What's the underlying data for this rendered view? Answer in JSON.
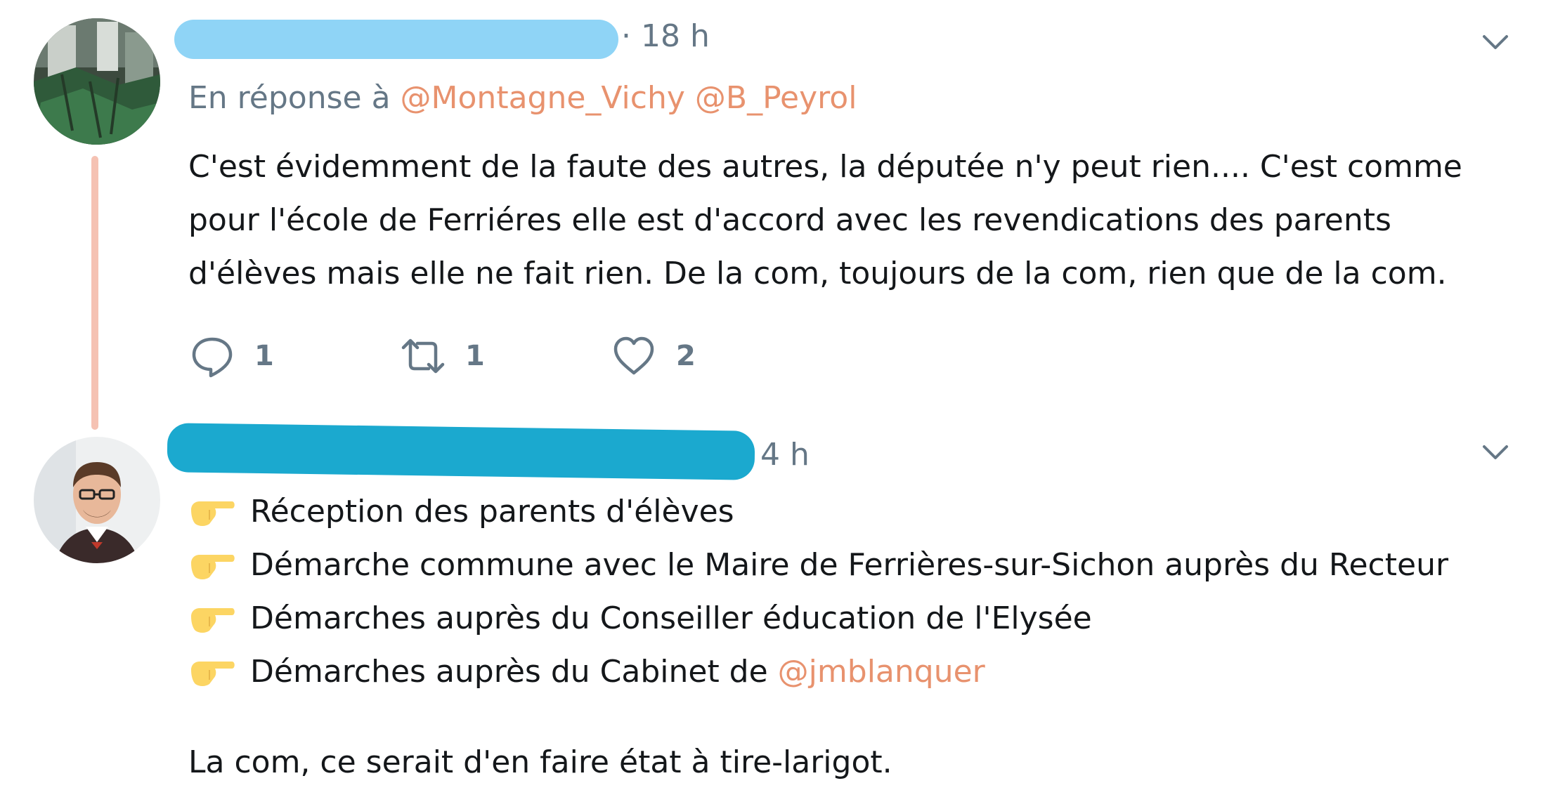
{
  "tweets": [
    {
      "timestamp": "· 18 h",
      "reply_prefix": "En réponse à",
      "reply_mentions": [
        "@Montagne_Vichy",
        "@B_Peyrol"
      ],
      "text_lines": [
        "C'est évidemment de la faute des autres, la députée n'y peut rien.... C'est comme",
        "pour l'école de Ferriéres elle est d'accord avec les revendications des parents",
        "d'élèves mais elle ne fait rien. De la com, toujours de la com, rien que de la com."
      ],
      "actions": {
        "reply_count": "1",
        "retweet_count": "1",
        "like_count": "2"
      },
      "icons": [
        "reply-icon",
        "retweet-icon",
        "like-icon",
        "chevron-down-icon"
      ]
    },
    {
      "timestamp": "4 h",
      "bullets": [
        {
          "text": "Réception des parents d'élèves"
        },
        {
          "text": "Démarche commune avec le Maire de Ferrières-sur-Sichon auprès du Recteur"
        },
        {
          "text": "Démarches auprès du Conseiller éducation de l'Elysée"
        },
        {
          "text": "Démarches auprès du Cabinet de ",
          "mention": "@jmblanquer"
        }
      ],
      "closing_text": "La com, ce serait d'en faire état à tire-larigot.",
      "icons": [
        "pointing-hand-emoji-icon",
        "chevron-down-icon"
      ]
    }
  ],
  "colors": {
    "mention": "#e8926e",
    "muted": "#657786",
    "thread_line": "#f5c2b3",
    "redaction_light": "#8fd4f6",
    "redaction_dark": "#1ba9cf",
    "emoji_hand": "#fcd563"
  }
}
